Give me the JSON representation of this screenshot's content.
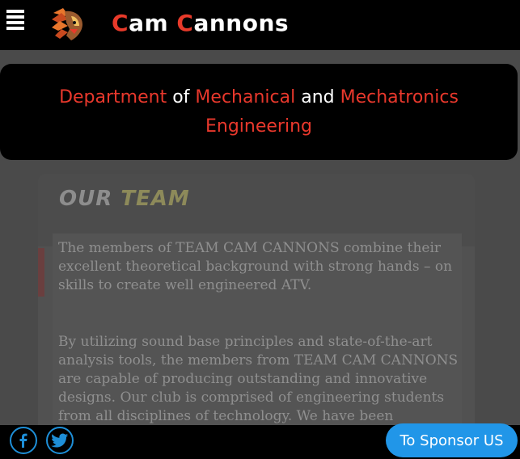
{
  "header": {
    "brand_first_initial": "C",
    "brand_first_rest": "am",
    "brand_second_initial": "C",
    "brand_second_rest": "annons",
    "menu_icon": "hamburger-icon",
    "logo_icon": "native-chief-head-logo"
  },
  "banner": {
    "word1": "Department",
    "word2": "of",
    "word3": "Mechanical",
    "word4": "and",
    "word5": "Mechatronics",
    "word6": "Engineering"
  },
  "section": {
    "title_part1": "OUR",
    "title_part2": "TEAM",
    "paragraph1": "The members of TEAM CAM CANNONS combine their excellent theoretical background with strong hands – on skills to create well engineered ATV.",
    "paragraph2": "By utilizing sound base principles and state-of-the-art analysis tools, the members from TEAM CAM CANNONS are capable of producing outstanding  and innovative designs. Our club is comprised of  engineering  students from all disciplines of  technology. We have been"
  },
  "footer": {
    "facebook_icon": "facebook-icon",
    "twitter_icon": "twitter-icon",
    "sponsor_label": "To Sponsor US"
  },
  "colors": {
    "accent_red": "#e8382c",
    "social_blue": "#1e8fd8",
    "sponsor_blue": "#2196e8"
  }
}
